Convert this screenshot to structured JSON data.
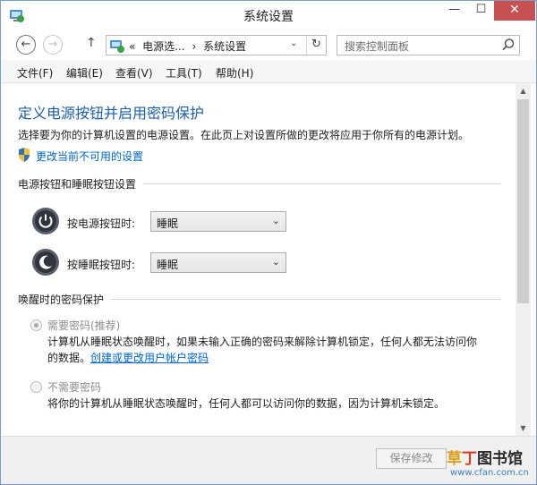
{
  "window": {
    "title": "系统设置",
    "controls": {
      "minimize": "—",
      "maximize": "☐",
      "close": "✕"
    }
  },
  "navbar": {
    "back_glyph": "←",
    "forward_glyph": "→",
    "up_glyph": "↑",
    "breadcrumb": [
      "«",
      "电源选...",
      "›",
      "系统设置"
    ],
    "dropdown_glyph": "⌄",
    "refresh_glyph": "↻",
    "search_placeholder": "搜索控制面板"
  },
  "menu": [
    "文件(F)",
    "编辑(E)",
    "查看(V)",
    "工具(T)",
    "帮助(H)"
  ],
  "content": {
    "title": "定义电源按钮并启用密码保护",
    "description": "选择要为你的计算机设置的电源设置。在此页上对设置所做的更改将应用于你所有的电源计划。",
    "change_link": "更改当前不可用的设置",
    "power_section": {
      "heading": "电源按钮和睡眠按钮设置",
      "rows": [
        {
          "label": "按电源按钮时:",
          "value": "睡眠",
          "icon": "power-button-icon"
        },
        {
          "label": "按睡眠按钮时:",
          "value": "睡眠",
          "icon": "sleep-button-icon"
        }
      ]
    },
    "password_section": {
      "heading": "唤醒时的密码保护",
      "options": [
        {
          "label": "需要密码(推荐)",
          "checked": true,
          "desc_line1": "计算机从睡眠状态唤醒时，如果未输入正确的密码来解除计算机锁定，任何人都无法访问你",
          "desc_line2_prefix": "的数据。",
          "desc_link": "创建或更改用户帐户密码"
        },
        {
          "label": "不需要密码",
          "checked": false,
          "desc_line1": "将你的计算机从睡眠状态唤醒时，任何人都可以访问你的数据，因为计算机未锁定。"
        }
      ]
    }
  },
  "footer": {
    "save_label": "保存修改",
    "watermark": {
      "part1": "草",
      "part2": "丁",
      "part3": "图书馆",
      "url": "www.cfan.com.cn"
    }
  },
  "colors": {
    "accent": "#1c5fa9",
    "link": "#0066cc",
    "close": "#c75050"
  }
}
